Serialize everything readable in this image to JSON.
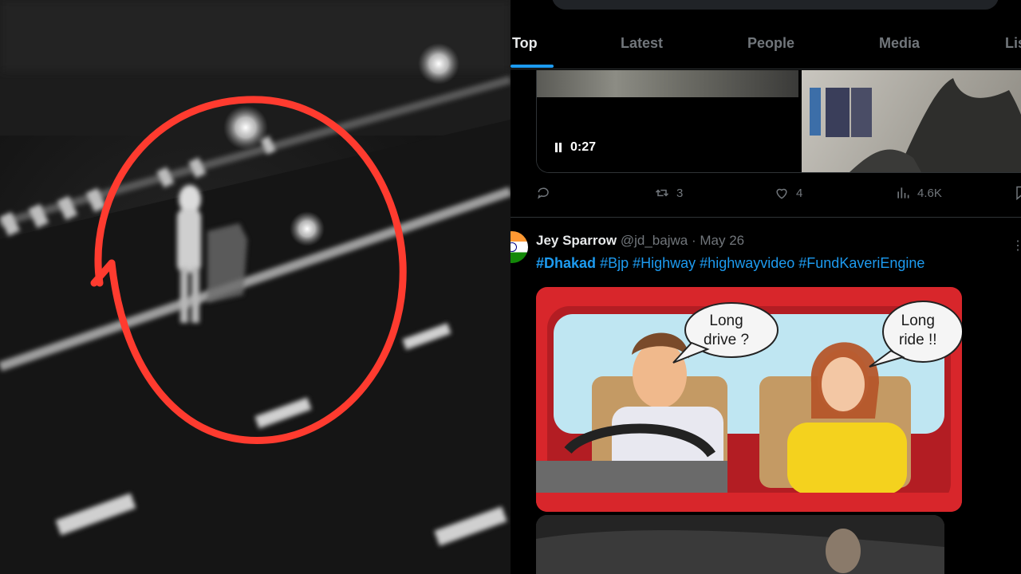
{
  "tabs": [
    {
      "label": "Top",
      "active": true
    },
    {
      "label": "Latest",
      "active": false
    },
    {
      "label": "People",
      "active": false
    },
    {
      "label": "Media",
      "active": false
    },
    {
      "label": "Lis",
      "active": false
    }
  ],
  "previous_post": {
    "video_time": "0:27",
    "actions": {
      "reply_icon": "reply-icon",
      "retweets": "3",
      "likes": "4",
      "views": "4.6K"
    }
  },
  "post": {
    "author_name": "Jey Sparrow",
    "handle": "@jd_bajwa",
    "separator": "·",
    "date": "May 26",
    "hashtags": [
      "#Dhakad",
      "#Bjp",
      "#Highway",
      "#highwayvideo",
      "#FundKaveriEngine"
    ],
    "comic": {
      "bubble_left": [
        "Long",
        "drive ?"
      ],
      "bubble_right": [
        "Long",
        "ride !!"
      ]
    }
  },
  "colors": {
    "accent": "#1d9bf0",
    "highlight_circle": "#ff3b2f",
    "muted_text": "#71767b"
  }
}
